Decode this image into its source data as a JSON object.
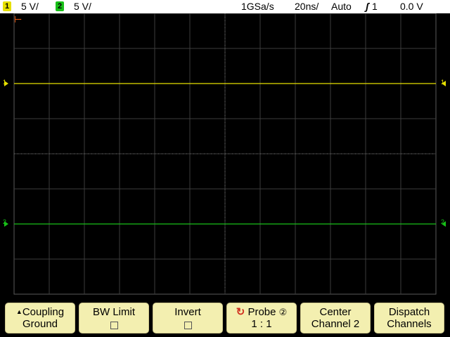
{
  "status_bar": {
    "ch1_number": "1",
    "ch1_scale": "5 V/",
    "ch2_number": "2",
    "ch2_scale": "5 V/",
    "sample_rate": "1GSa/s",
    "timebase": "20ns/",
    "trigger_mode": "Auto",
    "trigger_icon": "rising-edge-icon",
    "trigger_source": "1",
    "trigger_level": "0.0 V"
  },
  "screen": {
    "trigger_position_marker": "trigger-position-icon",
    "ch1_marker_label": "1",
    "ch2_marker_label": "2",
    "ch1_right_label": "1",
    "ch2_right_label": "2",
    "ch1_level_fraction": 0.25,
    "ch2_level_fraction": 0.75,
    "colors": {
      "background": "#000000",
      "grid": "#3c3c3c",
      "ch1": "#e6e000",
      "ch2": "#18c018",
      "trigger_marker": "#ff6010"
    }
  },
  "softkeys": [
    {
      "line1": "Coupling",
      "line2": "Ground",
      "icon": "up-triangle-icon"
    },
    {
      "line1": "BW Limit",
      "line2": "",
      "icon": "checkbox",
      "checked": false
    },
    {
      "line1": "Invert",
      "line2": "",
      "icon": "checkbox",
      "checked": false
    },
    {
      "line1": "Probe",
      "line2": "1 : 1",
      "icon": "cycle-icon",
      "badge": "②"
    },
    {
      "line1": "Center",
      "line2": "Channel 2"
    },
    {
      "line1": "Dispatch",
      "line2": "Channels"
    }
  ]
}
